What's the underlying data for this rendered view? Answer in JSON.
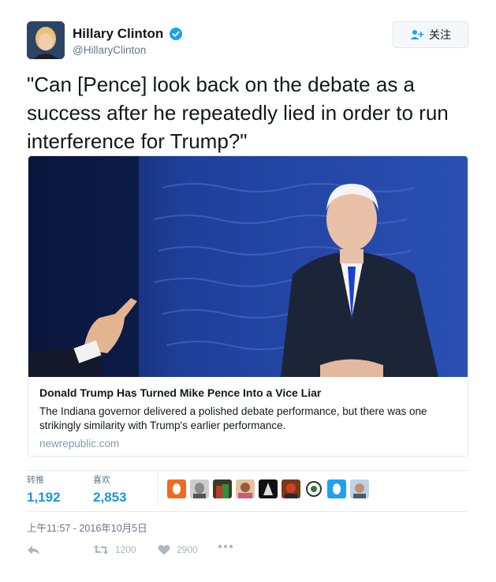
{
  "author": {
    "display_name": "Hillary Clinton",
    "handle": "@HillaryClinton",
    "verified": true,
    "follow_label": "关注"
  },
  "tweet": {
    "text": "\"Can [Pence] look back on the debate as a success after he repeatedly lied in order to run interference for Trump?\""
  },
  "card": {
    "image_alt": "Mike Pence at the vice presidential debate",
    "title": "Donald Trump Has Turned Mike Pence Into a Vice Liar",
    "description": "The Indiana governor delivered a polished debate performance, but there was one strikingly similarity with Trump's earlier performance.",
    "domain": "newrepublic.com"
  },
  "stats": {
    "retweets_label": "转推",
    "retweets_value": "1,192",
    "likes_label": "喜欢",
    "likes_value": "2,853",
    "liker_avatar_count": 10
  },
  "timestamp": "上午11:57 - 2016年10月5日",
  "actions": {
    "retweet_count": "1200",
    "like_count": "2900"
  },
  "colors": {
    "link_blue": "#1b95e0",
    "verified_blue": "#1da1f2",
    "muted": "#657786",
    "action_gray": "#aab8c2",
    "border": "#e1e8ed"
  }
}
